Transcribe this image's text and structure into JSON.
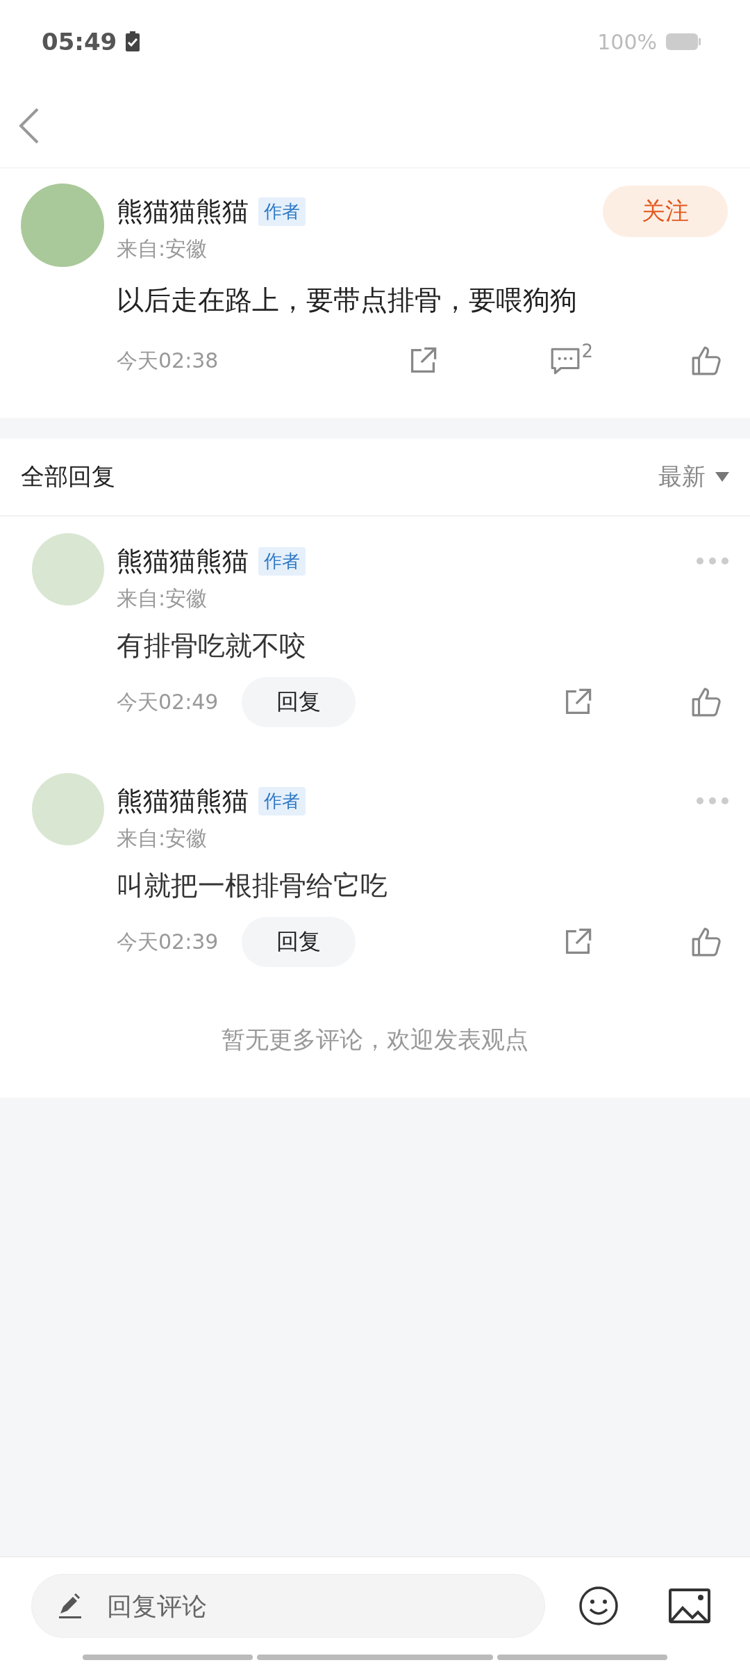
{
  "status_bar": {
    "time": "05:49",
    "battery": "100%"
  },
  "post": {
    "author": "熊猫猫熊猫",
    "badge": "作者",
    "location": "来自:安徽",
    "follow": "关注",
    "text": "以后走在路上，要带点排骨，要喂狗狗",
    "time": "今天02:38",
    "comment_count": "2"
  },
  "replies_header": {
    "title": "全部回复",
    "sort": "最新"
  },
  "replies": [
    {
      "author": "熊猫猫熊猫",
      "badge": "作者",
      "location": "来自:安徽",
      "text": "有排骨吃就不咬",
      "time": "今天02:49",
      "reply": "回复"
    },
    {
      "author": "熊猫猫熊猫",
      "badge": "作者",
      "location": "来自:安徽",
      "text": "叫就把一根排骨给它吃",
      "time": "今天02:39",
      "reply": "回复"
    }
  ],
  "end_note": "暂无更多评论，欢迎发表观点",
  "composer": {
    "placeholder": "回复评论"
  }
}
